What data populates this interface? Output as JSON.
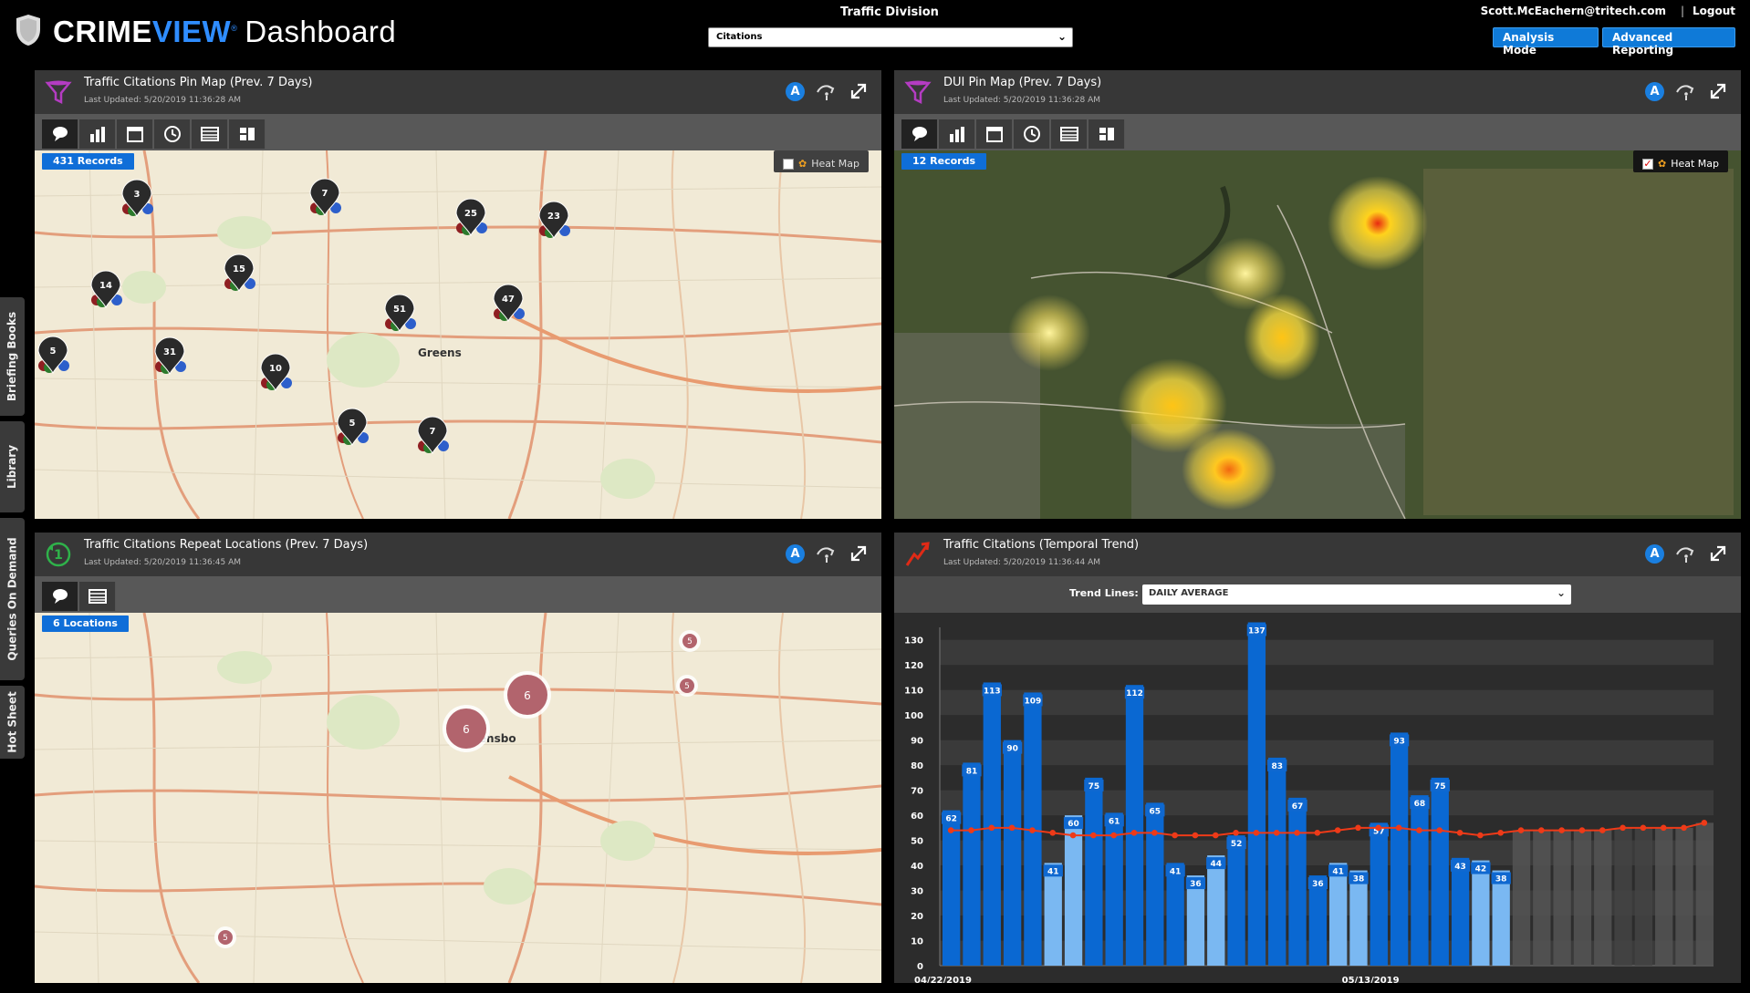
{
  "app": {
    "brand_crime": "CRIME",
    "brand_view": "VIEW",
    "brand_reg": "®",
    "brand_dashboard": "Dashboard",
    "division_title": "Traffic Division",
    "division_select": "Citations",
    "user": "Scott.McEachern@tritech.com",
    "separator": "|",
    "logout": "Logout",
    "analysis_mode": "Analysis Mode",
    "advanced_reporting": "Advanced Reporting"
  },
  "sidebar": {
    "tabs": [
      {
        "label": "Briefing Books"
      },
      {
        "label": "Library"
      },
      {
        "label": "Queries On Demand"
      },
      {
        "label": "Hot Sheet"
      }
    ]
  },
  "panels": {
    "pin_map": {
      "title": "Traffic Citations Pin Map (Prev. 7 Days)",
      "updated": "Last Updated: 5/20/2019 11:36:28 AM",
      "records": "431 Records",
      "heat_label": "Heat Map",
      "heat_on": false,
      "clusters": [
        "3",
        "7",
        "25",
        "23",
        "15",
        "14",
        "51",
        "47",
        "5",
        "31",
        "10",
        "5",
        "7"
      ],
      "map_labels": {
        "city": "Greens"
      }
    },
    "dui_map": {
      "title": "DUI Pin Map (Prev. 7 Days)",
      "updated": "Last Updated: 5/20/2019 11:36:28 AM",
      "records": "12 Records",
      "heat_label": "Heat Map",
      "heat_on": true
    },
    "repeat": {
      "title": "Traffic Citations Repeat Locations (Prev. 7 Days)",
      "updated": "Last Updated: 5/20/2019 11:36:45 AM",
      "records": "6 Locations",
      "clusters": [
        "6",
        "6",
        "5",
        "5",
        "5"
      ],
      "map_labels": {
        "city": "Greensbo"
      }
    },
    "trend": {
      "title": "Traffic Citations (Temporal Trend)",
      "updated": "Last Updated: 5/20/2019 11:36:44 AM",
      "trend_label": "Trend Lines:",
      "trend_value": "DAILY AVERAGE"
    }
  },
  "chart_data": {
    "type": "bar",
    "x_labels": [
      "04/22/2019",
      "05/13/2019"
    ],
    "values": [
      62,
      81,
      113,
      90,
      109,
      41,
      60,
      75,
      61,
      112,
      65,
      41,
      36,
      44,
      52,
      137,
      83,
      67,
      36,
      41,
      38,
      57,
      93,
      68,
      75,
      43,
      42,
      38
    ],
    "weekend": [
      false,
      false,
      false,
      false,
      false,
      true,
      true,
      false,
      false,
      false,
      false,
      false,
      true,
      true,
      false,
      false,
      false,
      false,
      false,
      true,
      true,
      false,
      false,
      false,
      false,
      false,
      true,
      true
    ],
    "avg_line": [
      54,
      54,
      55,
      55,
      54,
      53,
      52,
      52,
      52,
      53,
      53,
      52,
      52,
      52,
      53,
      53,
      53,
      53,
      53,
      54,
      55,
      55,
      55,
      54,
      54,
      53,
      52,
      53,
      54,
      54,
      54,
      54,
      54,
      55,
      55,
      55,
      55,
      57
    ],
    "future_days": 10,
    "ylim": [
      0,
      135
    ],
    "yticks": [
      0,
      10,
      20,
      30,
      40,
      50,
      60,
      70,
      80,
      90,
      100,
      110,
      120,
      130
    ],
    "colors": {
      "bar": "#0a68d2",
      "weekend_bar": "#7ab8f2",
      "avg": "#ee3a18",
      "future_a": "#555555",
      "future_b": "#444444"
    }
  }
}
